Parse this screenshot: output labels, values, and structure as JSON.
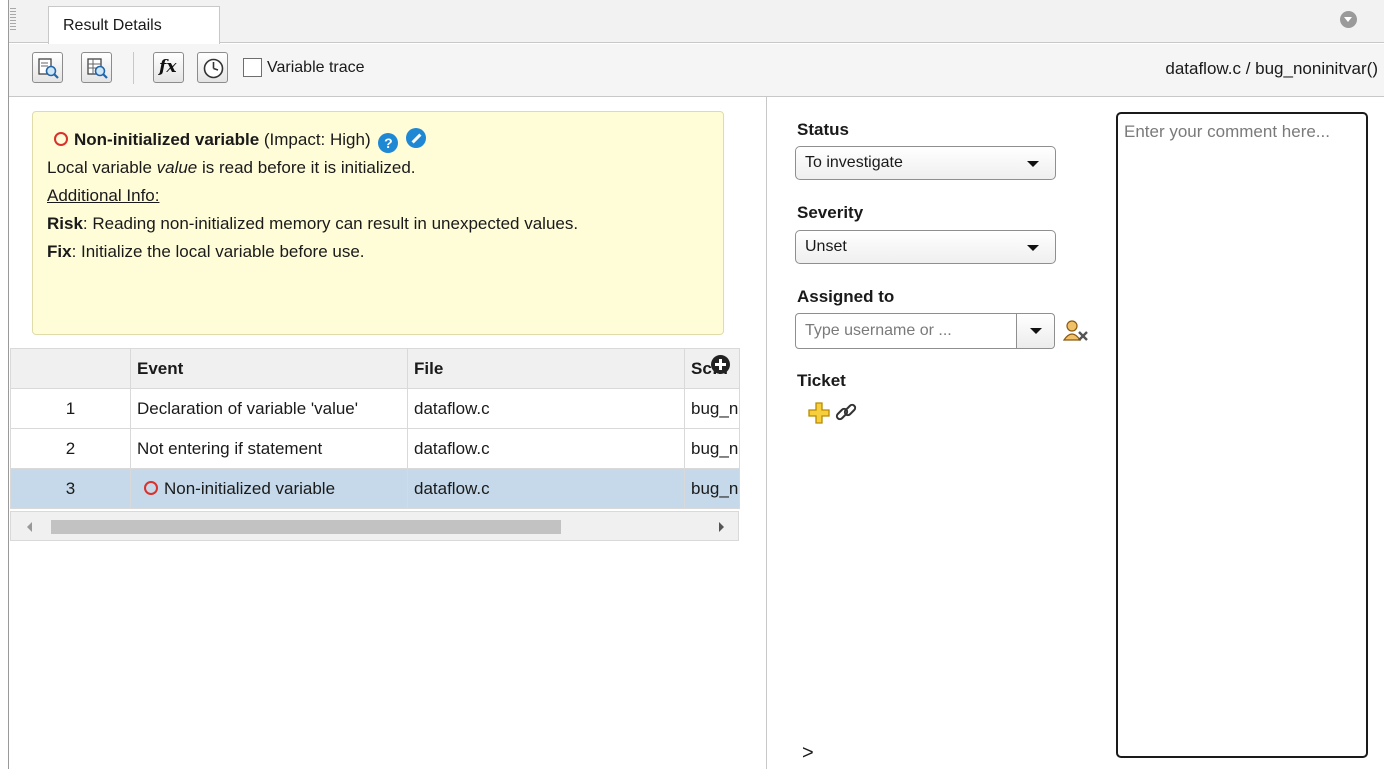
{
  "tab": {
    "label": "Result Details"
  },
  "toolbar": {
    "variable_trace_label": "Variable trace",
    "variable_trace_checked": false,
    "location": "dataflow.c / bug_noninitvar()"
  },
  "result": {
    "title": "Non-initialized variable",
    "impact": " (Impact: High)",
    "desc_prefix": "Local variable ",
    "desc_var": "value",
    "desc_suffix": " is read before it is initialized.",
    "additional_info_label": "Additional Info:",
    "risk_label": "Risk",
    "risk_text": ": Reading non-initialized memory can result in unexpected values.",
    "fix_label": "Fix",
    "fix_text": ": Initialize the local variable before use.",
    "status_color": "#d9312b"
  },
  "events_table": {
    "headers": [
      "",
      "Event",
      "File",
      "Scope"
    ],
    "rows": [
      {
        "num": "1",
        "event": "Declaration of variable 'value'",
        "file": "dataflow.c",
        "scope": "bug_noninitvar()"
      },
      {
        "num": "2",
        "event": "Not entering if statement",
        "file": "dataflow.c",
        "scope": "bug_noninitvar()"
      },
      {
        "num": "3",
        "event": "Non-initialized variable",
        "file": "dataflow.c",
        "scope": "bug_noninitvar()"
      }
    ],
    "selected_row": 3
  },
  "form": {
    "status_label": "Status",
    "status_value": "To investigate",
    "severity_label": "Severity",
    "severity_value": "Unset",
    "assigned_label": "Assigned to",
    "assigned_placeholder": "Type username or ...",
    "ticket_label": "Ticket",
    "comment_placeholder": "Enter your comment here..."
  },
  "colors": {
    "info_bg": "#fffcd8",
    "selected_row_bg": "#c5d9ea",
    "help_icon": "#1e88d4"
  }
}
